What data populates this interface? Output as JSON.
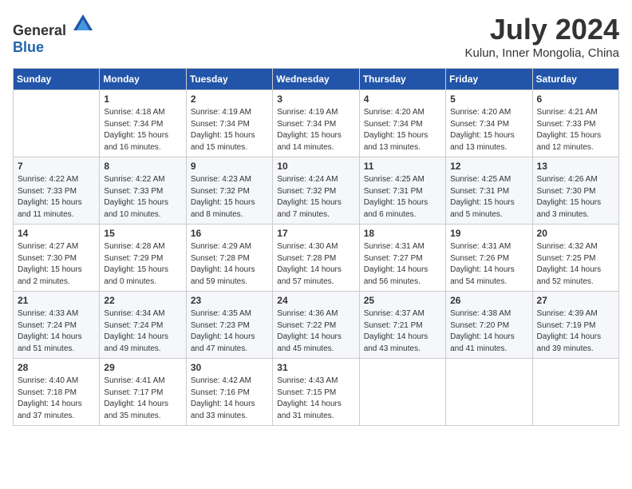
{
  "logo": {
    "general": "General",
    "blue": "Blue"
  },
  "title": "July 2024",
  "location": "Kulun, Inner Mongolia, China",
  "weekdays": [
    "Sunday",
    "Monday",
    "Tuesday",
    "Wednesday",
    "Thursday",
    "Friday",
    "Saturday"
  ],
  "weeks": [
    [
      {
        "day": "",
        "info": ""
      },
      {
        "day": "1",
        "info": "Sunrise: 4:18 AM\nSunset: 7:34 PM\nDaylight: 15 hours\nand 16 minutes."
      },
      {
        "day": "2",
        "info": "Sunrise: 4:19 AM\nSunset: 7:34 PM\nDaylight: 15 hours\nand 15 minutes."
      },
      {
        "day": "3",
        "info": "Sunrise: 4:19 AM\nSunset: 7:34 PM\nDaylight: 15 hours\nand 14 minutes."
      },
      {
        "day": "4",
        "info": "Sunrise: 4:20 AM\nSunset: 7:34 PM\nDaylight: 15 hours\nand 13 minutes."
      },
      {
        "day": "5",
        "info": "Sunrise: 4:20 AM\nSunset: 7:34 PM\nDaylight: 15 hours\nand 13 minutes."
      },
      {
        "day": "6",
        "info": "Sunrise: 4:21 AM\nSunset: 7:33 PM\nDaylight: 15 hours\nand 12 minutes."
      }
    ],
    [
      {
        "day": "7",
        "info": "Sunrise: 4:22 AM\nSunset: 7:33 PM\nDaylight: 15 hours\nand 11 minutes."
      },
      {
        "day": "8",
        "info": "Sunrise: 4:22 AM\nSunset: 7:33 PM\nDaylight: 15 hours\nand 10 minutes."
      },
      {
        "day": "9",
        "info": "Sunrise: 4:23 AM\nSunset: 7:32 PM\nDaylight: 15 hours\nand 8 minutes."
      },
      {
        "day": "10",
        "info": "Sunrise: 4:24 AM\nSunset: 7:32 PM\nDaylight: 15 hours\nand 7 minutes."
      },
      {
        "day": "11",
        "info": "Sunrise: 4:25 AM\nSunset: 7:31 PM\nDaylight: 15 hours\nand 6 minutes."
      },
      {
        "day": "12",
        "info": "Sunrise: 4:25 AM\nSunset: 7:31 PM\nDaylight: 15 hours\nand 5 minutes."
      },
      {
        "day": "13",
        "info": "Sunrise: 4:26 AM\nSunset: 7:30 PM\nDaylight: 15 hours\nand 3 minutes."
      }
    ],
    [
      {
        "day": "14",
        "info": "Sunrise: 4:27 AM\nSunset: 7:30 PM\nDaylight: 15 hours\nand 2 minutes."
      },
      {
        "day": "15",
        "info": "Sunrise: 4:28 AM\nSunset: 7:29 PM\nDaylight: 15 hours\nand 0 minutes."
      },
      {
        "day": "16",
        "info": "Sunrise: 4:29 AM\nSunset: 7:28 PM\nDaylight: 14 hours\nand 59 minutes."
      },
      {
        "day": "17",
        "info": "Sunrise: 4:30 AM\nSunset: 7:28 PM\nDaylight: 14 hours\nand 57 minutes."
      },
      {
        "day": "18",
        "info": "Sunrise: 4:31 AM\nSunset: 7:27 PM\nDaylight: 14 hours\nand 56 minutes."
      },
      {
        "day": "19",
        "info": "Sunrise: 4:31 AM\nSunset: 7:26 PM\nDaylight: 14 hours\nand 54 minutes."
      },
      {
        "day": "20",
        "info": "Sunrise: 4:32 AM\nSunset: 7:25 PM\nDaylight: 14 hours\nand 52 minutes."
      }
    ],
    [
      {
        "day": "21",
        "info": "Sunrise: 4:33 AM\nSunset: 7:24 PM\nDaylight: 14 hours\nand 51 minutes."
      },
      {
        "day": "22",
        "info": "Sunrise: 4:34 AM\nSunset: 7:24 PM\nDaylight: 14 hours\nand 49 minutes."
      },
      {
        "day": "23",
        "info": "Sunrise: 4:35 AM\nSunset: 7:23 PM\nDaylight: 14 hours\nand 47 minutes."
      },
      {
        "day": "24",
        "info": "Sunrise: 4:36 AM\nSunset: 7:22 PM\nDaylight: 14 hours\nand 45 minutes."
      },
      {
        "day": "25",
        "info": "Sunrise: 4:37 AM\nSunset: 7:21 PM\nDaylight: 14 hours\nand 43 minutes."
      },
      {
        "day": "26",
        "info": "Sunrise: 4:38 AM\nSunset: 7:20 PM\nDaylight: 14 hours\nand 41 minutes."
      },
      {
        "day": "27",
        "info": "Sunrise: 4:39 AM\nSunset: 7:19 PM\nDaylight: 14 hours\nand 39 minutes."
      }
    ],
    [
      {
        "day": "28",
        "info": "Sunrise: 4:40 AM\nSunset: 7:18 PM\nDaylight: 14 hours\nand 37 minutes."
      },
      {
        "day": "29",
        "info": "Sunrise: 4:41 AM\nSunset: 7:17 PM\nDaylight: 14 hours\nand 35 minutes."
      },
      {
        "day": "30",
        "info": "Sunrise: 4:42 AM\nSunset: 7:16 PM\nDaylight: 14 hours\nand 33 minutes."
      },
      {
        "day": "31",
        "info": "Sunrise: 4:43 AM\nSunset: 7:15 PM\nDaylight: 14 hours\nand 31 minutes."
      },
      {
        "day": "",
        "info": ""
      },
      {
        "day": "",
        "info": ""
      },
      {
        "day": "",
        "info": ""
      }
    ]
  ]
}
